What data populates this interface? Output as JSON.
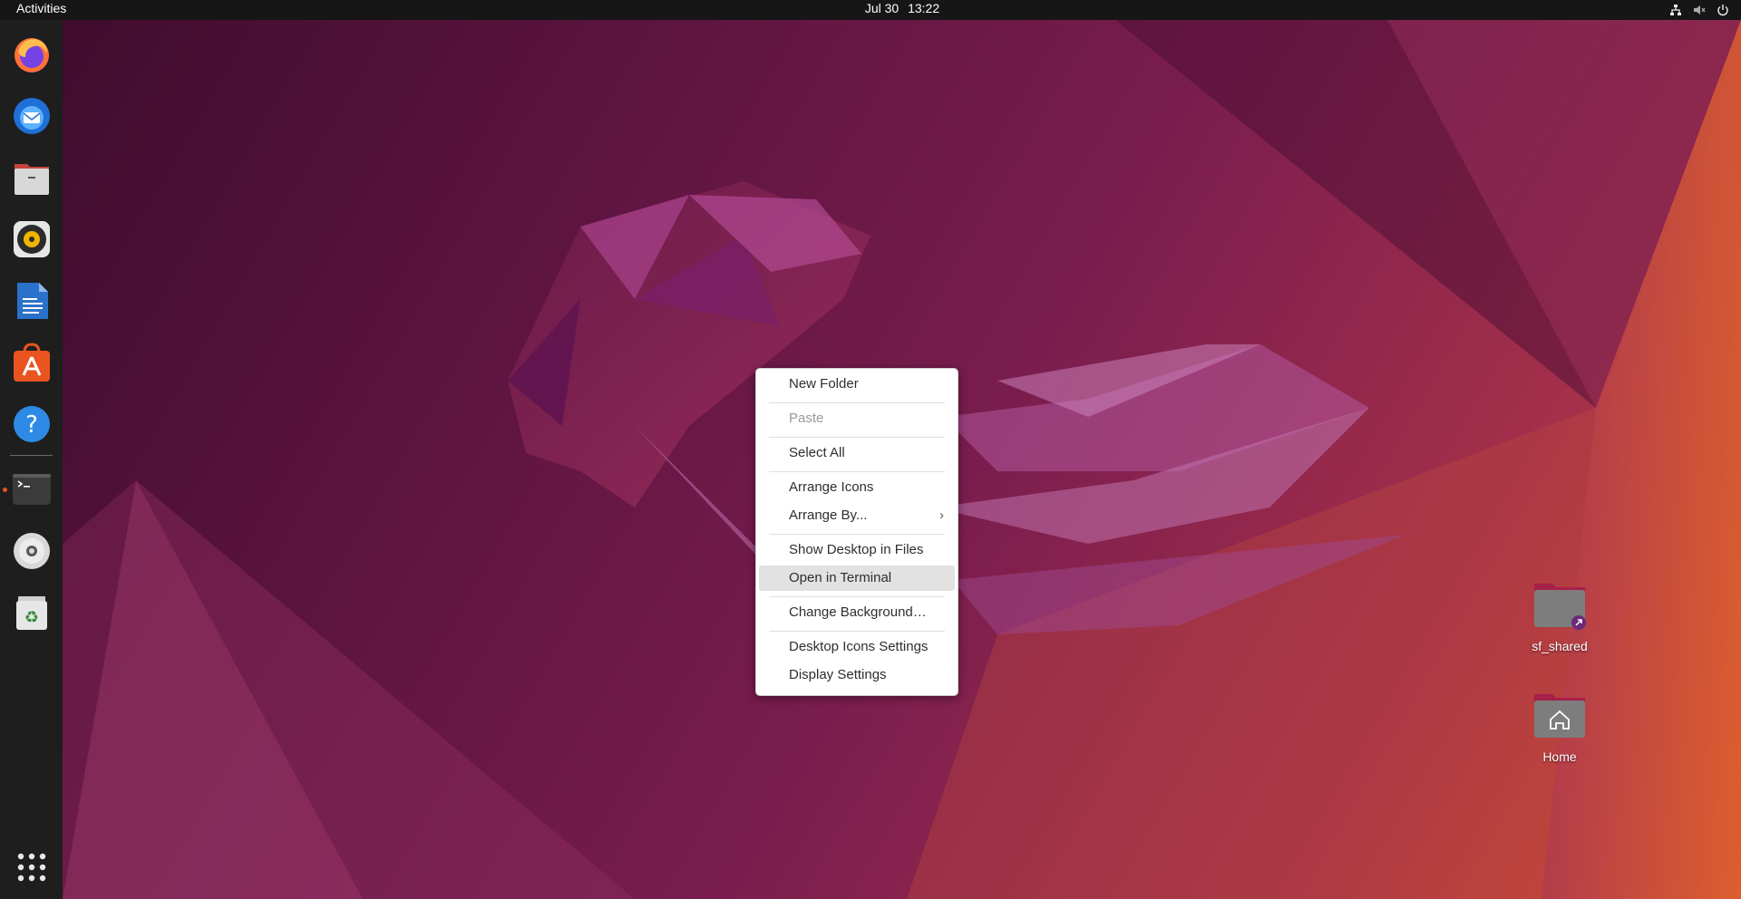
{
  "topbar": {
    "activities_label": "Activities",
    "clock_date": "Jul 30",
    "clock_time": "13:22",
    "tray_icons": [
      "network-icon",
      "volume-muted-icon",
      "power-icon"
    ]
  },
  "dock": {
    "items": [
      {
        "name": "Firefox",
        "icon": "firefox-icon"
      },
      {
        "name": "Thunderbird",
        "icon": "thunderbird-icon"
      },
      {
        "name": "Files",
        "icon": "files-icon"
      },
      {
        "name": "Rhythmbox",
        "icon": "rhythmbox-icon"
      },
      {
        "name": "LibreOffice Writer",
        "icon": "writer-icon"
      },
      {
        "name": "Ubuntu Software",
        "icon": "software-icon"
      },
      {
        "name": "Help",
        "icon": "help-icon"
      },
      {
        "name": "Terminal",
        "icon": "terminal-icon"
      },
      {
        "name": "Disc",
        "icon": "disc-icon"
      },
      {
        "name": "Trash",
        "icon": "trash-icon"
      }
    ],
    "show_apps_icon": "app-grid-icon"
  },
  "context_menu": {
    "items": [
      {
        "label": "New Folder"
      },
      {
        "label": "Paste",
        "disabled": true
      },
      {
        "label": "Select All"
      },
      {
        "label": "Arrange Icons"
      },
      {
        "label": "Arrange By...",
        "has_submenu": true
      },
      {
        "label": "Show Desktop in Files"
      },
      {
        "label": "Open in Terminal",
        "highlighted": true
      },
      {
        "label": "Change Background…"
      },
      {
        "label": "Desktop Icons Settings"
      },
      {
        "label": "Display Settings"
      }
    ],
    "submenu_arrow": "›"
  },
  "desktop_icons": [
    {
      "label": "sf_shared",
      "icon": "shared-folder-icon"
    },
    {
      "label": "Home",
      "icon": "home-folder-icon"
    }
  ],
  "colors": {
    "accent": "#e95420",
    "topbar": "#161616",
    "dock": "#1e1e1e",
    "menu_bg": "#ffffff",
    "menu_highlight": "#e2e2e2"
  }
}
